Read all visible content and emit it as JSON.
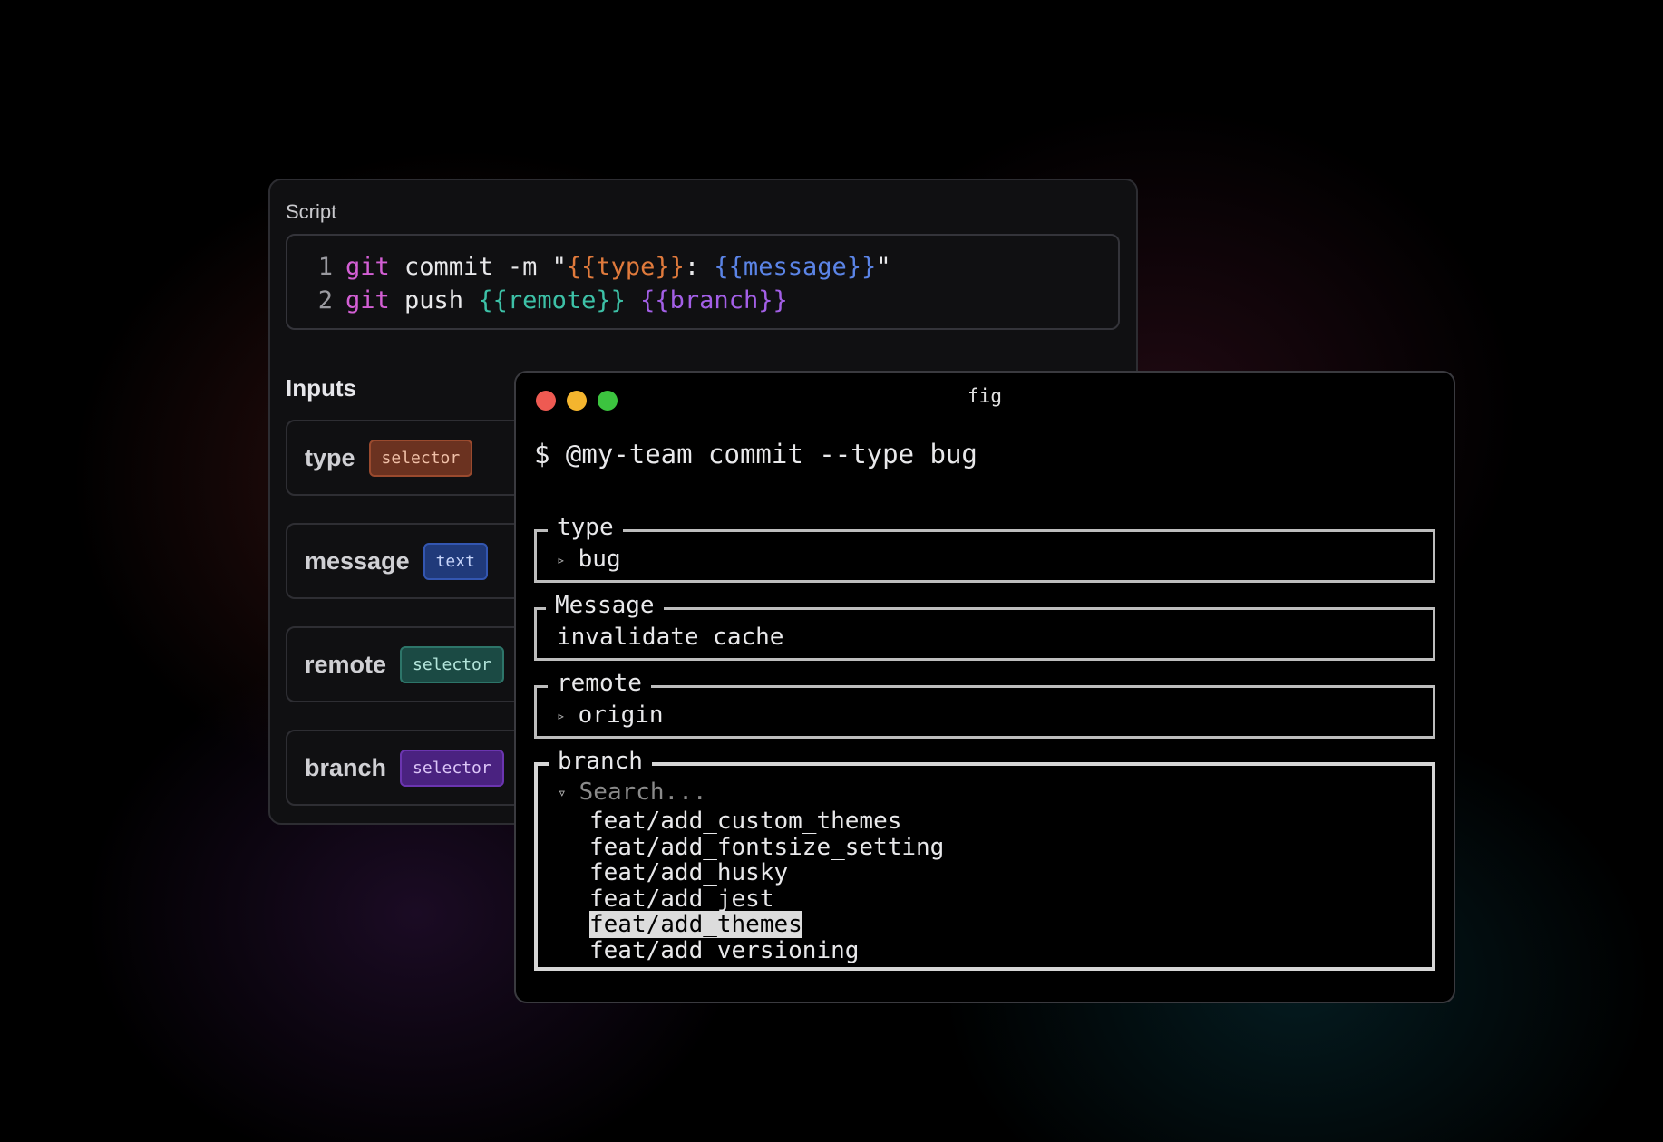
{
  "script_panel": {
    "script_label": "Script",
    "code": {
      "line1": {
        "num": "1",
        "kw": "git",
        "t1": " commit -m \"",
        "type_var": "{{type}}",
        "t2": ": ",
        "msg_var": "{{message}}",
        "t3": "\""
      },
      "line2": {
        "num": "2",
        "kw": "git",
        "t1": " push ",
        "remote_var": "{{remote}}",
        "t2": " ",
        "branch_var": "{{branch}}"
      }
    },
    "inputs_label": "Inputs",
    "inputs": [
      {
        "name": "type",
        "badge": "selector",
        "color": "#e07a3c"
      },
      {
        "name": "message",
        "badge": "text",
        "color": "#5b84e6"
      },
      {
        "name": "remote",
        "badge": "selector",
        "color": "#3dc1a7"
      },
      {
        "name": "branch",
        "badge": "selector",
        "color": "#a35fe6"
      }
    ]
  },
  "terminal": {
    "title": "fig",
    "prompt": "$ @my-team commit --type bug",
    "fields": {
      "type": {
        "label": "type",
        "caret": "▹",
        "value": "bug"
      },
      "message": {
        "label": "Message",
        "value": "invalidate cache"
      },
      "remote": {
        "label": "remote",
        "caret": "▹",
        "value": "origin"
      },
      "branch": {
        "label": "branch",
        "caret": "▿",
        "placeholder": "Search...",
        "options": [
          "feat/add_custom_themes",
          "feat/add_fontsize_setting",
          "feat/add_husky",
          "feat/add_jest",
          "feat/add_themes",
          "feat/add_versioning"
        ],
        "selected": "feat/add_themes"
      }
    }
  }
}
